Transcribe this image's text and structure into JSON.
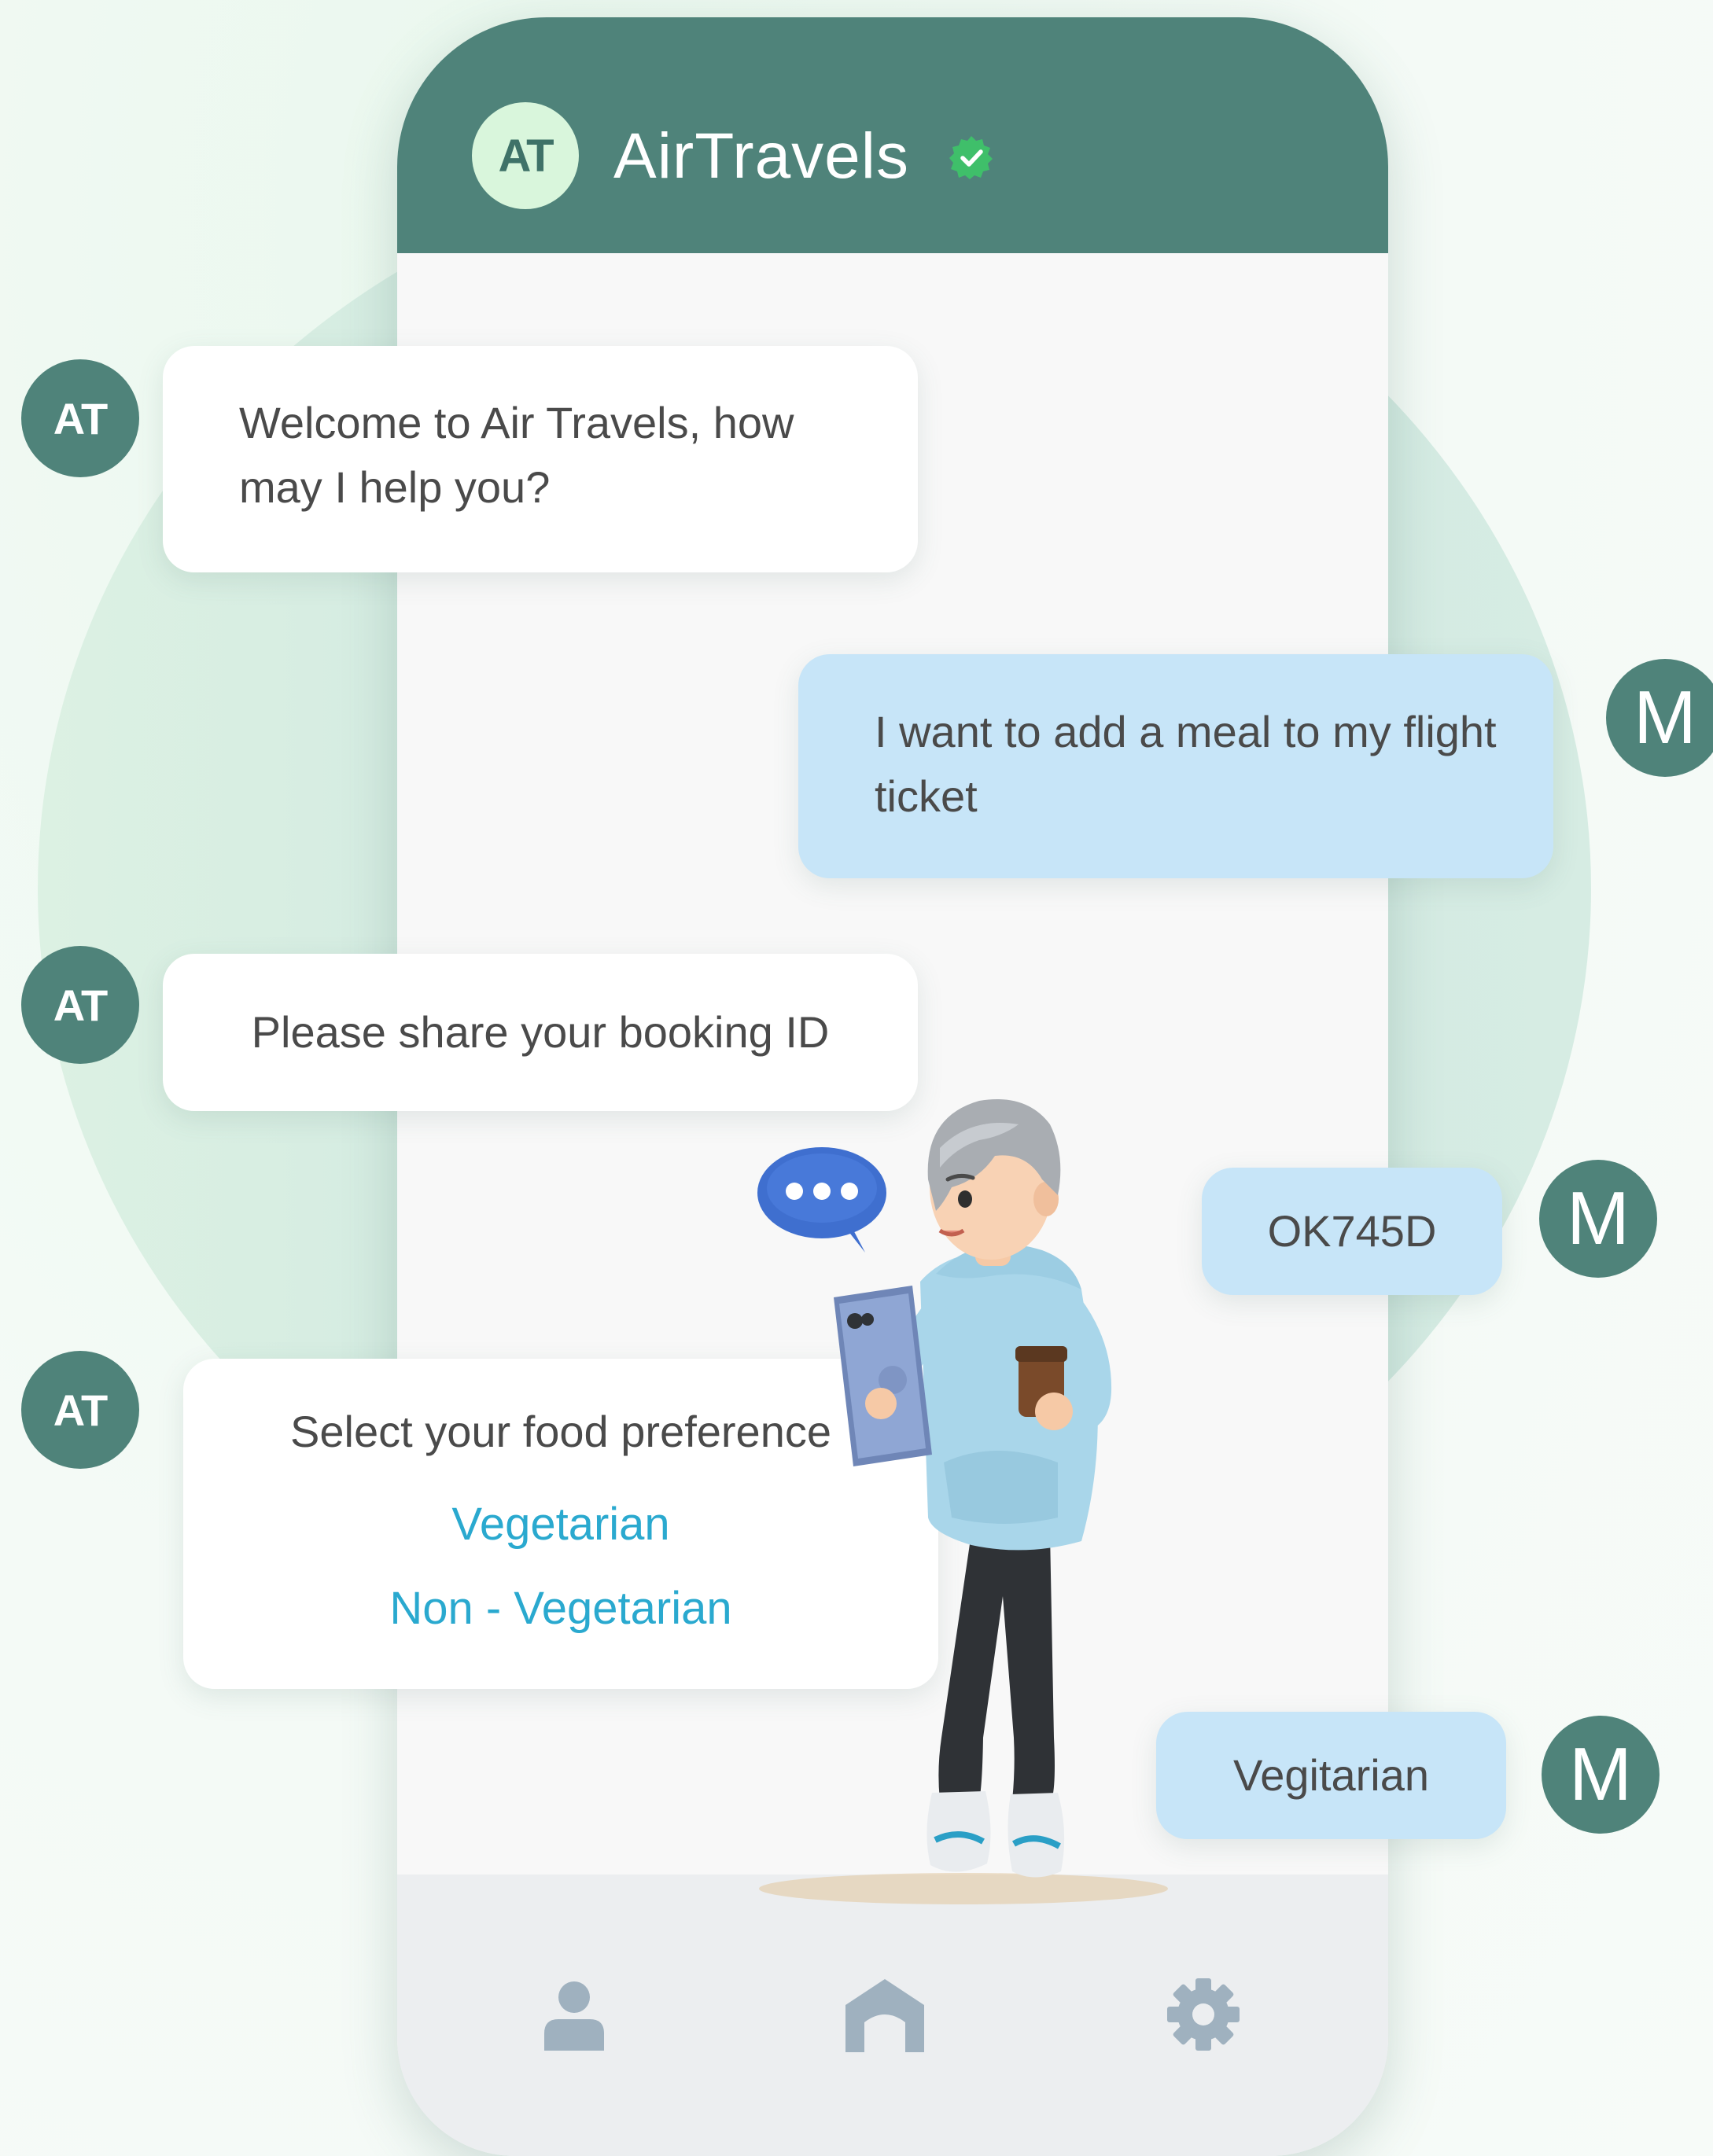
{
  "app": {
    "avatar_initials": "AT",
    "title": "AirTravels",
    "verified": true
  },
  "messages": [
    {
      "from": "bot",
      "avatar": "AT",
      "text": "Welcome to Air Travels, how may I help you?"
    },
    {
      "from": "user",
      "avatar": "M",
      "text": "I want to add a meal to my flight ticket"
    },
    {
      "from": "bot",
      "avatar": "AT",
      "text": "Please share your booking ID"
    },
    {
      "from": "user",
      "avatar": "M",
      "text": "OK745D"
    },
    {
      "from": "bot",
      "avatar": "AT",
      "text": "Select your food preference",
      "options": [
        "Vegetarian",
        "Non - Vegetarian"
      ]
    },
    {
      "from": "user",
      "avatar": "M",
      "text": "Vegitarian"
    }
  ],
  "nav": [
    {
      "icon": "profile-icon"
    },
    {
      "icon": "home-icon"
    },
    {
      "icon": "settings-icon"
    }
  ],
  "colors": {
    "brand": "#4f837a",
    "avatar_light": "#d9f6dc",
    "user_bubble": "#c7e5f8",
    "option_link": "#2aa9cf",
    "verified": "#3fbf6a"
  }
}
